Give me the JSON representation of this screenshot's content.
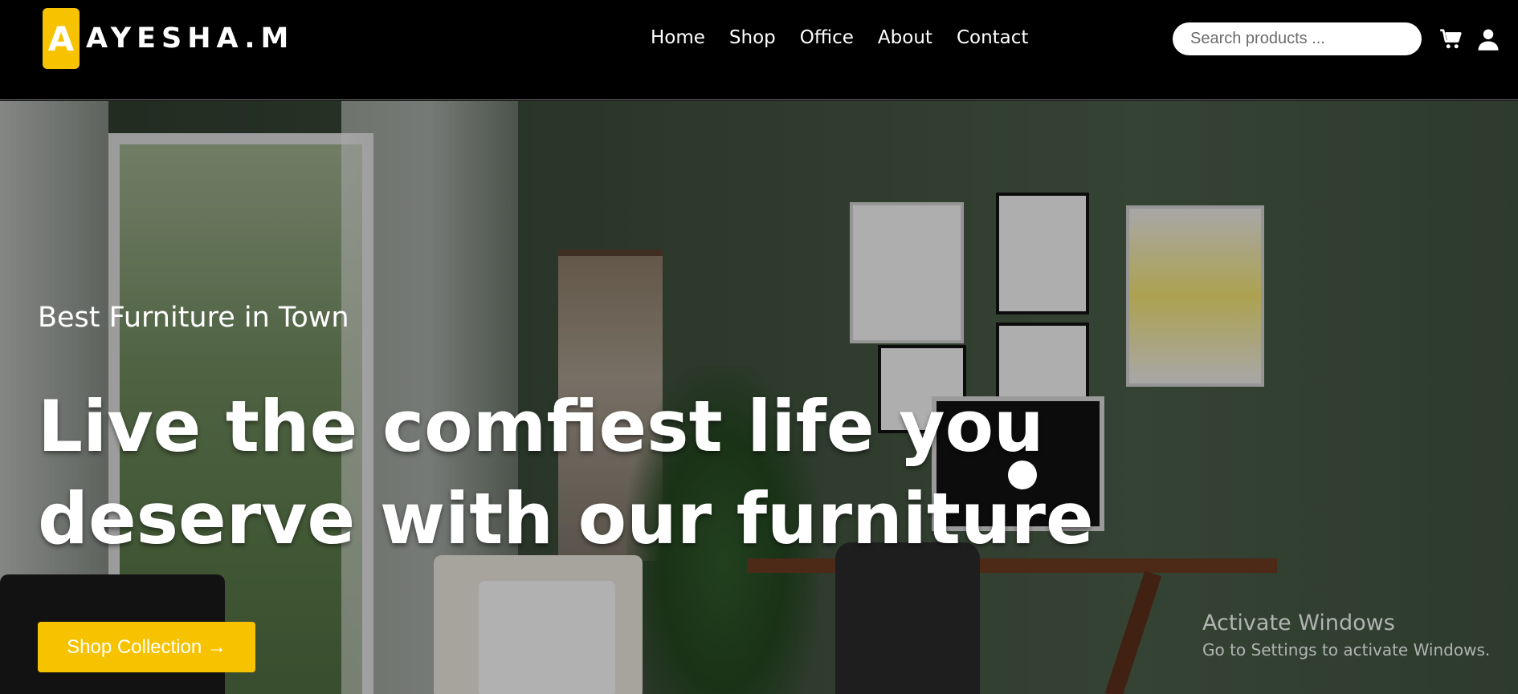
{
  "brand": {
    "badge_letter": "A",
    "name": "AYESHA.M",
    "accent_color": "#f7c300"
  },
  "nav": {
    "items": [
      "Home",
      "Shop",
      "Office",
      "About",
      "Contact"
    ]
  },
  "search": {
    "placeholder": "Search products ..."
  },
  "icons": {
    "cart": "cart-icon",
    "user": "user-icon"
  },
  "hero": {
    "tagline": "Best Furniture in Town",
    "headline_line1": "Live the comfiest life you",
    "headline_line2": "deserve with our furniture",
    "cta_label": "Shop Collection →"
  },
  "watermark": {
    "title": "Activate Windows",
    "subtitle": "Go to Settings to activate Windows."
  }
}
